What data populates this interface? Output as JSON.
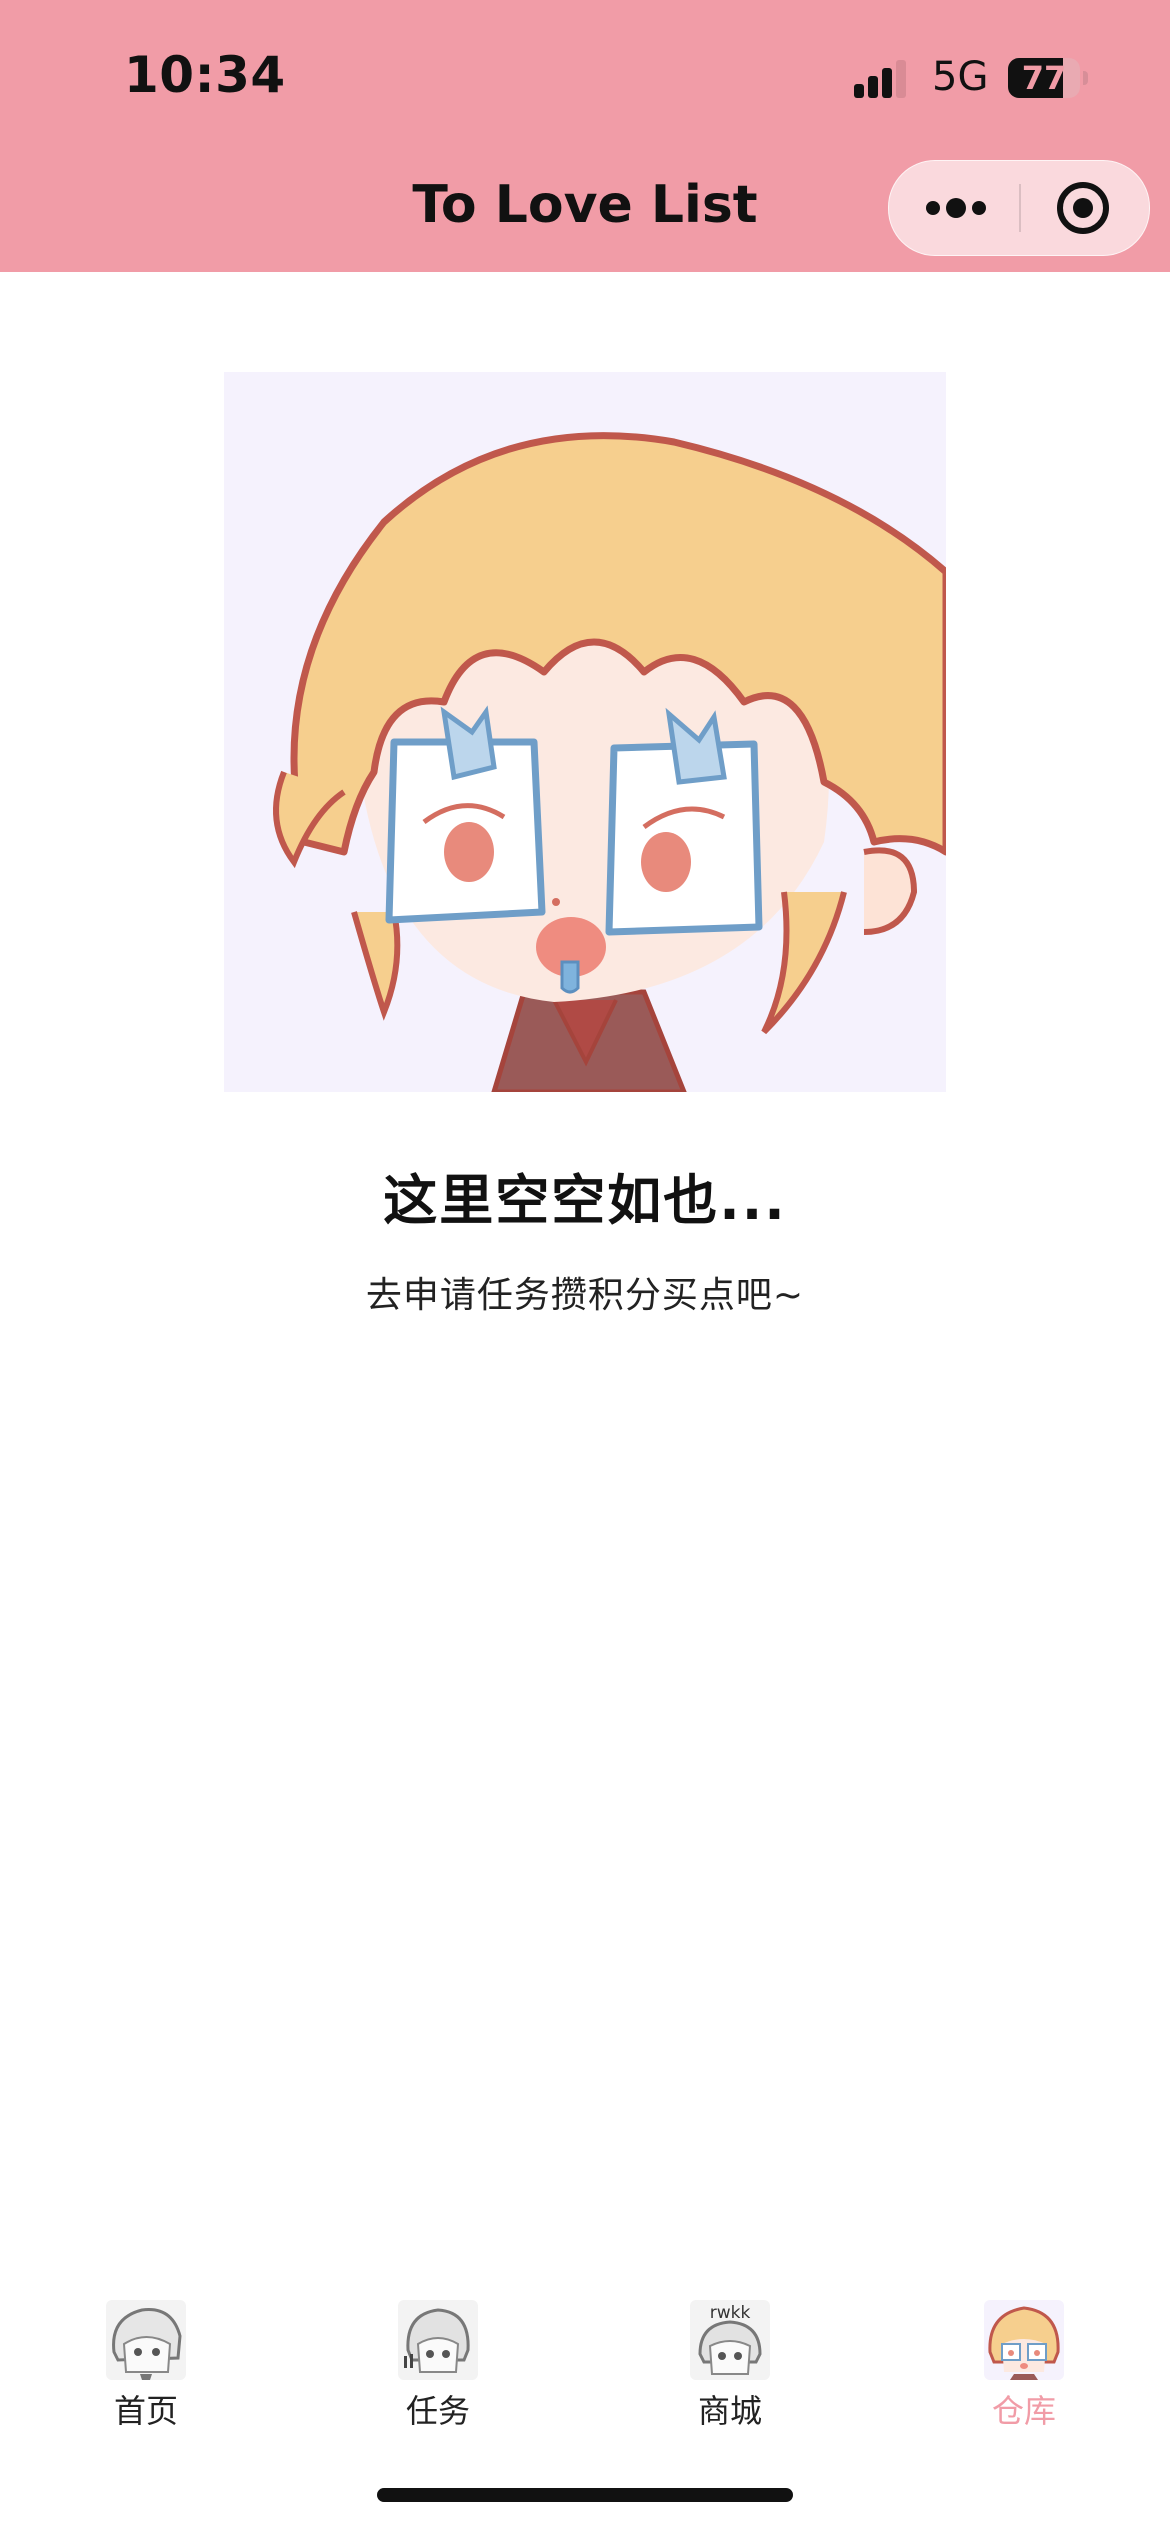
{
  "status_bar": {
    "time": "10:34",
    "network": "5G",
    "battery_level": "77",
    "battery_fraction": 0.77
  },
  "nav_bar": {
    "title": "To Love List",
    "more_icon": "more-dots-icon",
    "close_icon": "target-close-icon"
  },
  "empty_state": {
    "illustration": "chibi-character-with-paper-glasses",
    "title": "这里空空如也...",
    "subtitle": "去申请任务攒积分买点吧~"
  },
  "tab_bar": {
    "items": [
      {
        "label": "首页",
        "icon": "chibi-avatar-home-icon",
        "active": false
      },
      {
        "label": "任务",
        "icon": "chibi-avatar-tasks-icon",
        "active": false
      },
      {
        "label": "商城",
        "icon": "chibi-avatar-shop-icon",
        "icon_text": "rwkk",
        "active": false
      },
      {
        "label": "仓库",
        "icon": "chibi-avatar-warehouse-icon",
        "active": true
      }
    ]
  },
  "colors": {
    "accent": "#f19ca7",
    "illustration_background": "#f5f2fd",
    "hair": "#f6cf8e",
    "outline": "#c0584c",
    "glasses": "#6f9ec8"
  }
}
